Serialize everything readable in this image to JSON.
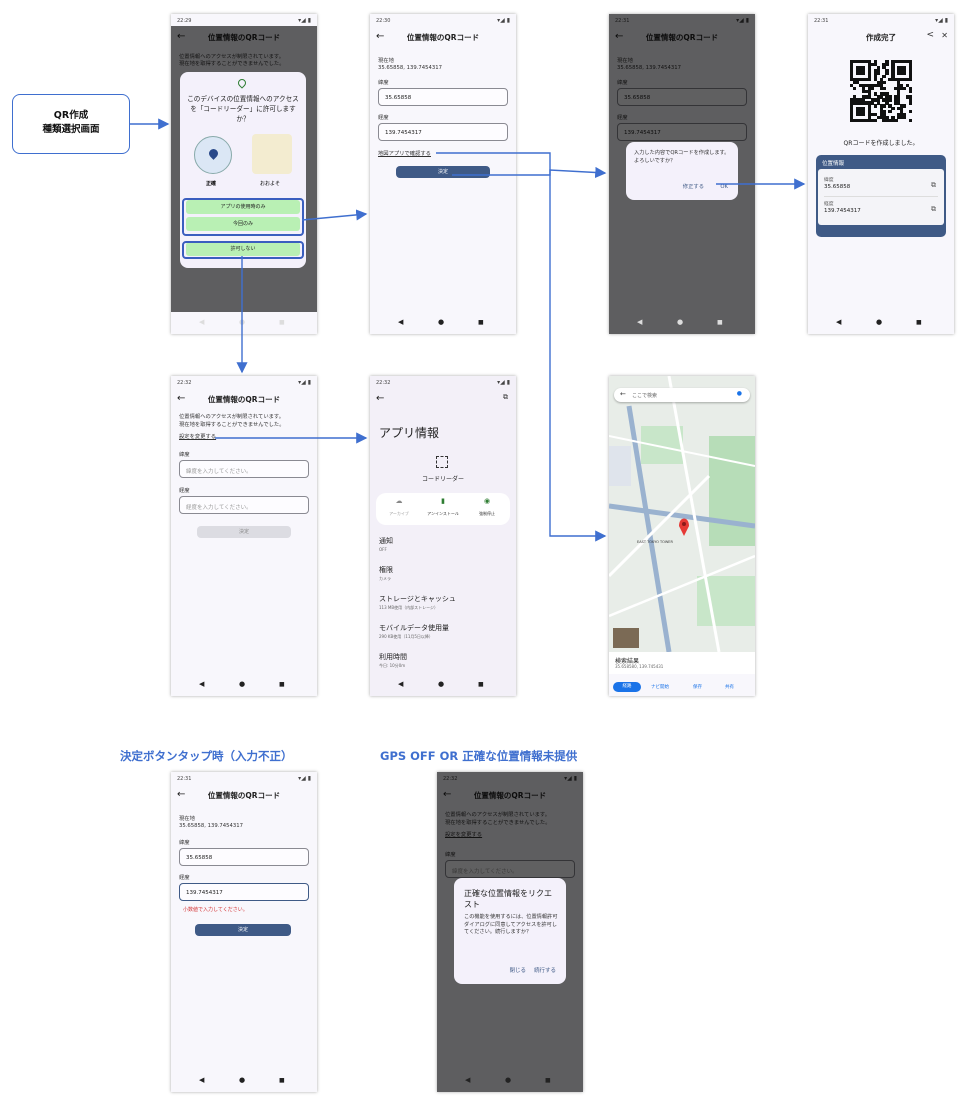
{
  "annotations": {
    "start_box_line1": "QR作成",
    "start_box_line2": "種類選択画面",
    "invalid_input": "決定ボタンタップ時（入力不正）",
    "gps_off": "GPS OFF OR 正確な位置情報未提供"
  },
  "status": {
    "time1": "22:29",
    "time2": "22:30",
    "time3": "22:31",
    "time4": "22:32",
    "signal": "▾◢ ▮"
  },
  "common": {
    "screen_title": "位置情報のQRコード",
    "back": "←",
    "nav_back": "◀",
    "nav_home": "●",
    "nav_recent": "■",
    "denied_notice_1": "位置情報へのアクセスが制限されています。",
    "denied_notice_2": "現在地を取得することができませんでした。",
    "lat_label": "緯度",
    "lng_label": "経度",
    "lat_placeholder": "緯度を入力してください。",
    "lng_placeholder": "経度を入力してください。",
    "decide": "決定",
    "latitude": "35.65858",
    "longitude": "139.7454317",
    "current_location_label": "現在地",
    "current_location_value": "35.65858, 139.7454317"
  },
  "screen1": {
    "perm_title": "このデバイスの位置情報へのアクセスを「コードリーダー」に許可しますか？",
    "precise": "正確",
    "approximate": "おおよそ",
    "while_using": "アプリの使用時のみ",
    "only_this_time": "今回のみ",
    "deny": "許可しない"
  },
  "screen2": {
    "map_link": "地図アプリで確認する"
  },
  "screen3": {
    "confirm_text": "入力した内容でQRコードを作成します。よろしいですか？",
    "fix": "修正する",
    "ok": "OK"
  },
  "screen4": {
    "title": "作成完了",
    "share": "<",
    "close": "✕",
    "created": "QRコードを作成しました。",
    "card_title": "位置情報",
    "lat_key": "緯度",
    "lng_key": "経度",
    "copy": "⧉"
  },
  "screen5": {
    "change_settings": "設定を変更する"
  },
  "screen6": {
    "open": "⧉",
    "title": "アプリ情報",
    "app_name": "コードリーダー",
    "archive": "アーカイブ",
    "uninstall": "アンインストール",
    "force_stop": "強制停止",
    "items": [
      {
        "title": "通知",
        "sub": "OFF"
      },
      {
        "title": "権限",
        "sub": "カメラ"
      },
      {
        "title": "ストレージとキャッシュ",
        "sub": "113 MB使用（内部ストレージ）"
      },
      {
        "title": "モバイルデータ使用量",
        "sub": "290 KB使用（11月5日以降）"
      },
      {
        "title": "利用時間",
        "sub": "今日: 10分0m"
      }
    ]
  },
  "screen7": {
    "search_placeholder": "ここで検索",
    "result_title": "検索結果",
    "result_coords": "35.658580, 139.745431",
    "route": "経路",
    "navigate": "ナビ開始",
    "save": "保存",
    "share": "共有",
    "tower_label": "EAST TOKYO TOWER"
  },
  "screen8": {
    "error": "小数値で入力してください。"
  },
  "screen9": {
    "dialog_title": "正確な位置情報をリクエスト",
    "dialog_body": "この機能を使用するには、位置情報許可ダイアログに同意してアクセスを許可してください。続行しますか？",
    "close": "閉じる",
    "continue": "続行する"
  },
  "colors": {
    "accent_blue": "#3f6fcf",
    "button_dark": "#3f5a86",
    "perm_green": "#b9f0b4",
    "error_red": "#d32f2f"
  }
}
